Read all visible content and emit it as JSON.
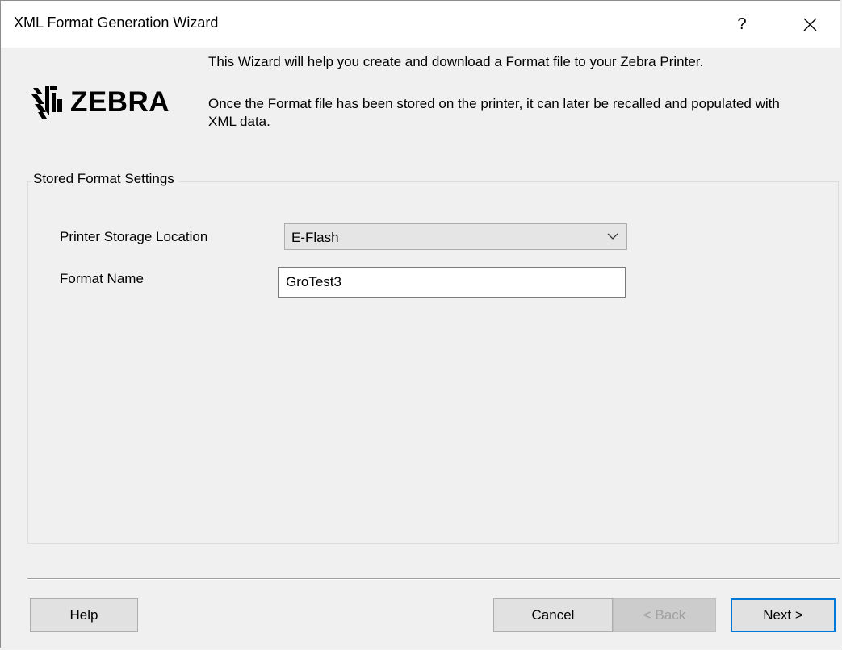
{
  "window": {
    "title": "XML Format Generation Wizard",
    "help_glyph": "?",
    "close_glyph": "✕"
  },
  "header": {
    "logo_text": "ZEBRA",
    "intro_line1": "This Wizard will help you create and download a Format file to your Zebra Printer.",
    "intro_line2": "Once the Format file has been stored on the printer, it can later be recalled and populated with XML data."
  },
  "settings": {
    "group_title": "Stored Format Settings",
    "storage_label": "Printer Storage Location",
    "storage_value": "E-Flash",
    "format_name_label": "Format Name",
    "format_name_value": "GroTest3"
  },
  "buttons": {
    "help": "Help",
    "cancel": "Cancel",
    "back": "< Back",
    "next": "Next >"
  },
  "colors": {
    "accent": "#0078d7",
    "window_bg": "#f0f0f0",
    "disabled_text": "#a0a0a0"
  },
  "icons": {
    "logo": "zebra-logo-icon",
    "close": "close-icon",
    "dropdown": "chevron-down-icon"
  }
}
